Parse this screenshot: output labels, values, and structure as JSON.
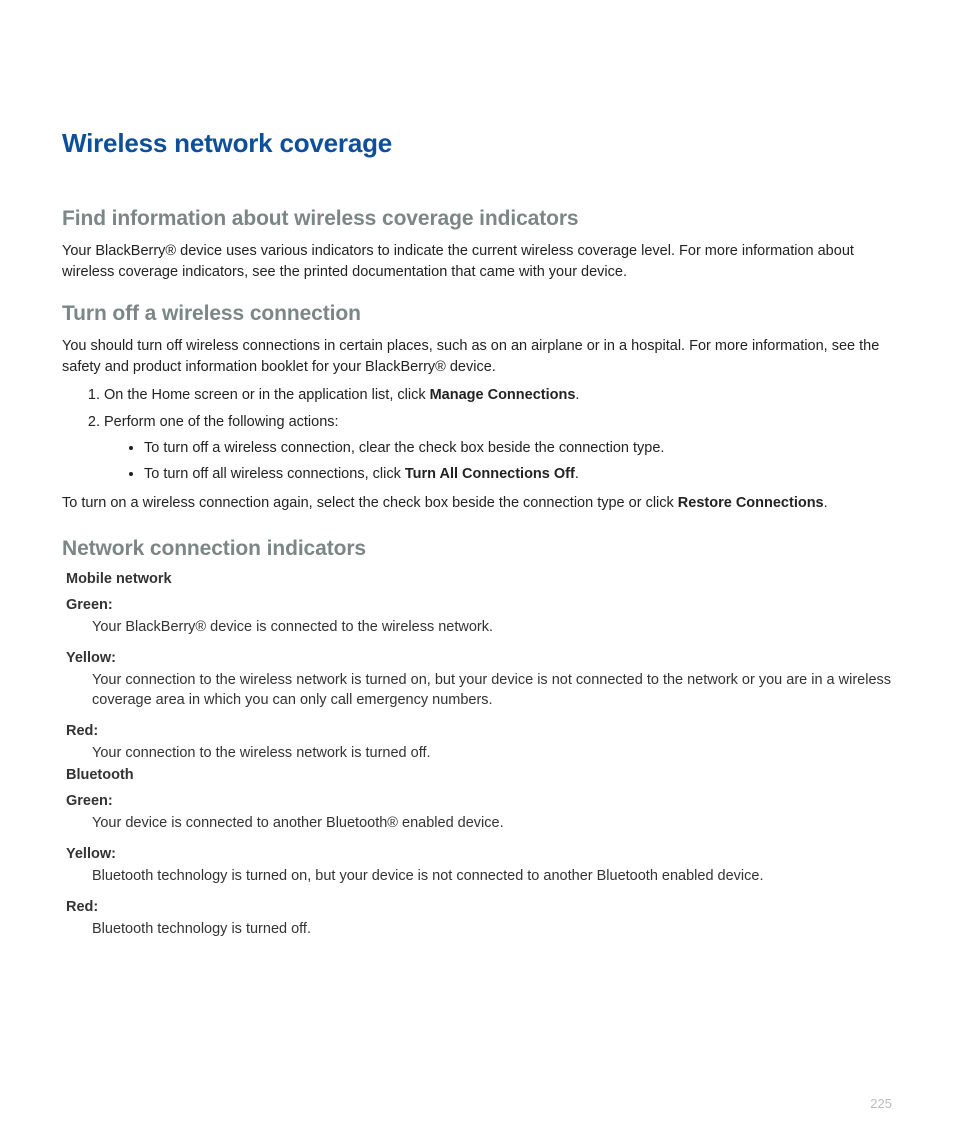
{
  "title": "Wireless network coverage",
  "section1": {
    "heading": "Find information about wireless coverage indicators",
    "body": "Your BlackBerry® device uses various indicators to indicate the current wireless coverage level. For more information about wireless coverage indicators, see the printed documentation that came with your device."
  },
  "section2": {
    "heading": "Turn off a wireless connection",
    "body": "You should turn off wireless connections in certain places, such as on an airplane or in a hospital. For more information, see the safety and product information booklet for your BlackBerry® device.",
    "steps": [
      {
        "pre": "On the Home screen or in the application list, click ",
        "bold": "Manage Connections",
        "post": "."
      },
      {
        "pre": "Perform one of the following actions:",
        "bold": "",
        "post": ""
      }
    ],
    "substeps": [
      {
        "pre": "To turn off a wireless connection, clear the check box beside the connection type.",
        "bold": "",
        "post": ""
      },
      {
        "pre": "To turn off all wireless connections, click ",
        "bold": "Turn All Connections Off",
        "post": "."
      }
    ],
    "after_pre": "To turn on a wireless connection again, select the check box beside the connection type or click ",
    "after_bold": "Restore Connections",
    "after_post": "."
  },
  "section3": {
    "heading": "Network connection indicators",
    "group1": {
      "title": "Mobile network",
      "items": [
        {
          "label": "Green",
          "desc": "Your BlackBerry® device is connected to the wireless network."
        },
        {
          "label": "Yellow",
          "desc": "Your connection to the wireless network is turned on, but your device is not connected to the network or you are in a wireless coverage area in which you can only call emergency numbers."
        },
        {
          "label": "Red",
          "desc": "Your connection to the wireless network is turned off."
        }
      ]
    },
    "group2": {
      "title": "Bluetooth",
      "items": [
        {
          "label": "Green",
          "desc": "Your device is connected to another Bluetooth® enabled device."
        },
        {
          "label": "Yellow",
          "desc": "Bluetooth technology is turned on, but your device is not connected to another Bluetooth enabled device."
        },
        {
          "label": "Red",
          "desc": "Bluetooth technology is turned off."
        }
      ]
    }
  },
  "page_number": "225"
}
